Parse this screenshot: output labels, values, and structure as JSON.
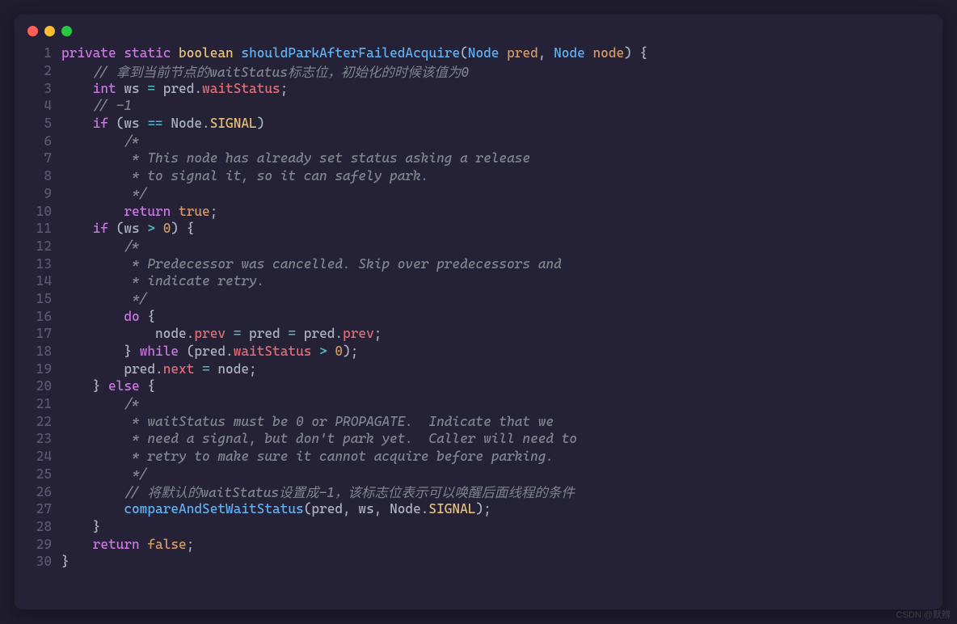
{
  "window": {
    "dots": [
      "close",
      "minimize",
      "maximize"
    ]
  },
  "watermark": "CSDN @默辨",
  "code": {
    "lines": [
      {
        "n": 1,
        "tokens": [
          {
            "t": "private",
            "c": "kw-private"
          },
          {
            "t": " ",
            "c": "plain"
          },
          {
            "t": "static",
            "c": "kw-static"
          },
          {
            "t": " ",
            "c": "plain"
          },
          {
            "t": "boolean",
            "c": "kw-boolean"
          },
          {
            "t": " ",
            "c": "plain"
          },
          {
            "t": "shouldParkAfterFailedAcquire",
            "c": "fn-name"
          },
          {
            "t": "(",
            "c": "punct"
          },
          {
            "t": "Node",
            "c": "type"
          },
          {
            "t": " ",
            "c": "plain"
          },
          {
            "t": "pred",
            "c": "param"
          },
          {
            "t": ", ",
            "c": "punct"
          },
          {
            "t": "Node",
            "c": "type"
          },
          {
            "t": " ",
            "c": "plain"
          },
          {
            "t": "node",
            "c": "param"
          },
          {
            "t": ") {",
            "c": "punct"
          }
        ]
      },
      {
        "n": 2,
        "tokens": [
          {
            "t": "    ",
            "c": "plain"
          },
          {
            "t": "// 拿到当前节点的waitStatus标志位，初始化的时候该值为0",
            "c": "comment"
          }
        ]
      },
      {
        "n": 3,
        "tokens": [
          {
            "t": "    ",
            "c": "plain"
          },
          {
            "t": "int",
            "c": "kw-int"
          },
          {
            "t": " ws ",
            "c": "ident"
          },
          {
            "t": "=",
            "c": "op"
          },
          {
            "t": " pred",
            "c": "ident"
          },
          {
            "t": ".",
            "c": "punct"
          },
          {
            "t": "waitStatus",
            "c": "prop"
          },
          {
            "t": ";",
            "c": "punct"
          }
        ]
      },
      {
        "n": 4,
        "tokens": [
          {
            "t": "    ",
            "c": "plain"
          },
          {
            "t": "// -1",
            "c": "comment"
          }
        ]
      },
      {
        "n": 5,
        "tokens": [
          {
            "t": "    ",
            "c": "plain"
          },
          {
            "t": "if",
            "c": "kw-if"
          },
          {
            "t": " (ws ",
            "c": "punct"
          },
          {
            "t": "==",
            "c": "op"
          },
          {
            "t": " Node",
            "c": "ident"
          },
          {
            "t": ".",
            "c": "punct"
          },
          {
            "t": "SIGNAL",
            "c": "const"
          },
          {
            "t": ")",
            "c": "punct"
          }
        ]
      },
      {
        "n": 6,
        "tokens": [
          {
            "t": "        ",
            "c": "plain"
          },
          {
            "t": "/*",
            "c": "comment"
          }
        ]
      },
      {
        "n": 7,
        "tokens": [
          {
            "t": "        ",
            "c": "plain"
          },
          {
            "t": " * This node has already set status asking a release",
            "c": "comment"
          }
        ]
      },
      {
        "n": 8,
        "tokens": [
          {
            "t": "        ",
            "c": "plain"
          },
          {
            "t": " * to signal it, so it can safely park.",
            "c": "comment"
          }
        ]
      },
      {
        "n": 9,
        "tokens": [
          {
            "t": "        ",
            "c": "plain"
          },
          {
            "t": " */",
            "c": "comment"
          }
        ]
      },
      {
        "n": 10,
        "tokens": [
          {
            "t": "        ",
            "c": "plain"
          },
          {
            "t": "return",
            "c": "kw-return"
          },
          {
            "t": " ",
            "c": "plain"
          },
          {
            "t": "true",
            "c": "bool"
          },
          {
            "t": ";",
            "c": "punct"
          }
        ]
      },
      {
        "n": 11,
        "tokens": [
          {
            "t": "    ",
            "c": "plain"
          },
          {
            "t": "if",
            "c": "kw-if"
          },
          {
            "t": " (ws ",
            "c": "punct"
          },
          {
            "t": ">",
            "c": "op"
          },
          {
            "t": " ",
            "c": "plain"
          },
          {
            "t": "0",
            "c": "number"
          },
          {
            "t": ") {",
            "c": "punct"
          }
        ]
      },
      {
        "n": 12,
        "tokens": [
          {
            "t": "        ",
            "c": "plain"
          },
          {
            "t": "/*",
            "c": "comment"
          }
        ]
      },
      {
        "n": 13,
        "tokens": [
          {
            "t": "        ",
            "c": "plain"
          },
          {
            "t": " * Predecessor was cancelled. Skip over predecessors and",
            "c": "comment"
          }
        ]
      },
      {
        "n": 14,
        "tokens": [
          {
            "t": "        ",
            "c": "plain"
          },
          {
            "t": " * indicate retry.",
            "c": "comment"
          }
        ]
      },
      {
        "n": 15,
        "tokens": [
          {
            "t": "        ",
            "c": "plain"
          },
          {
            "t": " */",
            "c": "comment"
          }
        ]
      },
      {
        "n": 16,
        "tokens": [
          {
            "t": "        ",
            "c": "plain"
          },
          {
            "t": "do",
            "c": "kw-do"
          },
          {
            "t": " {",
            "c": "punct"
          }
        ]
      },
      {
        "n": 17,
        "tokens": [
          {
            "t": "            node",
            "c": "ident"
          },
          {
            "t": ".",
            "c": "punct"
          },
          {
            "t": "prev",
            "c": "prop"
          },
          {
            "t": " ",
            "c": "plain"
          },
          {
            "t": "=",
            "c": "op"
          },
          {
            "t": " pred ",
            "c": "ident"
          },
          {
            "t": "=",
            "c": "op"
          },
          {
            "t": " pred",
            "c": "ident"
          },
          {
            "t": ".",
            "c": "punct"
          },
          {
            "t": "prev",
            "c": "prop"
          },
          {
            "t": ";",
            "c": "punct"
          }
        ]
      },
      {
        "n": 18,
        "tokens": [
          {
            "t": "        } ",
            "c": "punct"
          },
          {
            "t": "while",
            "c": "kw-while"
          },
          {
            "t": " (pred",
            "c": "ident"
          },
          {
            "t": ".",
            "c": "punct"
          },
          {
            "t": "waitStatus",
            "c": "prop"
          },
          {
            "t": " ",
            "c": "plain"
          },
          {
            "t": ">",
            "c": "op"
          },
          {
            "t": " ",
            "c": "plain"
          },
          {
            "t": "0",
            "c": "number"
          },
          {
            "t": ");",
            "c": "punct"
          }
        ]
      },
      {
        "n": 19,
        "tokens": [
          {
            "t": "        pred",
            "c": "ident"
          },
          {
            "t": ".",
            "c": "punct"
          },
          {
            "t": "next",
            "c": "prop"
          },
          {
            "t": " ",
            "c": "plain"
          },
          {
            "t": "=",
            "c": "op"
          },
          {
            "t": " node;",
            "c": "ident"
          }
        ]
      },
      {
        "n": 20,
        "tokens": [
          {
            "t": "    } ",
            "c": "punct"
          },
          {
            "t": "else",
            "c": "kw-else"
          },
          {
            "t": " {",
            "c": "punct"
          }
        ]
      },
      {
        "n": 21,
        "tokens": [
          {
            "t": "        ",
            "c": "plain"
          },
          {
            "t": "/*",
            "c": "comment"
          }
        ]
      },
      {
        "n": 22,
        "tokens": [
          {
            "t": "        ",
            "c": "plain"
          },
          {
            "t": " * waitStatus must be 0 or PROPAGATE.  Indicate that we",
            "c": "comment"
          }
        ]
      },
      {
        "n": 23,
        "tokens": [
          {
            "t": "        ",
            "c": "plain"
          },
          {
            "t": " * need a signal, but don't park yet.  Caller will need to",
            "c": "comment"
          }
        ]
      },
      {
        "n": 24,
        "tokens": [
          {
            "t": "        ",
            "c": "plain"
          },
          {
            "t": " * retry to make sure it cannot acquire before parking.",
            "c": "comment"
          }
        ]
      },
      {
        "n": 25,
        "tokens": [
          {
            "t": "        ",
            "c": "plain"
          },
          {
            "t": " */",
            "c": "comment"
          }
        ]
      },
      {
        "n": 26,
        "tokens": [
          {
            "t": "        ",
            "c": "plain"
          },
          {
            "t": "// 将默认的waitStatus设置成-1，该标志位表示可以唤醒后面线程的条件",
            "c": "comment"
          }
        ]
      },
      {
        "n": 27,
        "tokens": [
          {
            "t": "        ",
            "c": "plain"
          },
          {
            "t": "compareAndSetWaitStatus",
            "c": "call"
          },
          {
            "t": "(pred, ws, Node",
            "c": "ident"
          },
          {
            "t": ".",
            "c": "punct"
          },
          {
            "t": "SIGNAL",
            "c": "const"
          },
          {
            "t": ");",
            "c": "punct"
          }
        ]
      },
      {
        "n": 28,
        "tokens": [
          {
            "t": "    }",
            "c": "punct"
          }
        ]
      },
      {
        "n": 29,
        "tokens": [
          {
            "t": "    ",
            "c": "plain"
          },
          {
            "t": "return",
            "c": "kw-return"
          },
          {
            "t": " ",
            "c": "plain"
          },
          {
            "t": "false",
            "c": "bool"
          },
          {
            "t": ";",
            "c": "punct"
          }
        ]
      },
      {
        "n": 30,
        "tokens": [
          {
            "t": "}",
            "c": "punct"
          }
        ]
      }
    ]
  }
}
